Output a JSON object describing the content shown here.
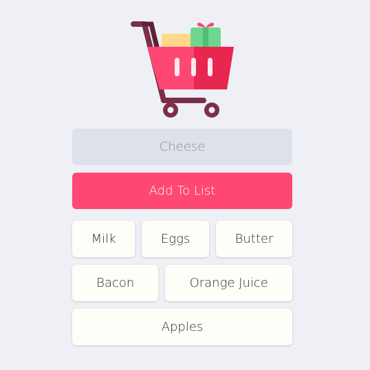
{
  "app": {
    "logo_icon": "shopping-cart-icon"
  },
  "form": {
    "input_placeholder": "Cheese",
    "input_value": "",
    "add_button_label": "Add To List"
  },
  "list": {
    "items": [
      {
        "label": "Milk"
      },
      {
        "label": "Eggs"
      },
      {
        "label": "Butter"
      },
      {
        "label": "Bacon"
      },
      {
        "label": "Orange Juice"
      },
      {
        "label": "Apples"
      }
    ]
  },
  "colors": {
    "background": "#eef0f5",
    "accent": "#ff4773",
    "input_background": "#dde2ea",
    "chip_background": "#fffdf7"
  }
}
